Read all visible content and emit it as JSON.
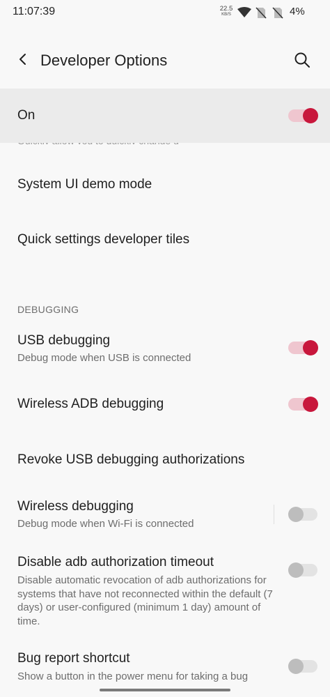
{
  "status_bar": {
    "time": "11:07:39",
    "net_speed_value": "22.5",
    "net_speed_unit": "KB/S",
    "battery": "4%",
    "icons": [
      "wifi-icon",
      "no-sim-icon",
      "no-sim-icon"
    ]
  },
  "app_bar": {
    "title": "Developer Options",
    "back_icon": "back-arrow-icon",
    "search_icon": "search-icon"
  },
  "master_switch": {
    "label": "On",
    "checked": true
  },
  "partially_hidden_summary": "Quickly allow you to quickly change g",
  "items": [
    {
      "title": "System UI demo mode"
    },
    {
      "title": "Quick settings developer tiles"
    }
  ],
  "debugging": {
    "header": "DEBUGGING",
    "items": [
      {
        "title": "USB debugging",
        "summary": "Debug mode when USB is connected",
        "checked": true
      },
      {
        "title": "Wireless ADB debugging",
        "checked": true
      },
      {
        "title": "Revoke USB debugging authorizations"
      },
      {
        "title": "Wireless debugging",
        "summary": "Debug mode when Wi-Fi is connected",
        "checked": false
      },
      {
        "title": "Disable adb authorization timeout",
        "summary": "Disable automatic revocation of adb authorizations for systems that have not reconnected within the default (7 days) or user-configured (minimum 1 day) amount of time.",
        "checked": false
      },
      {
        "title": "Bug report shortcut",
        "summary": "Show a button in the power menu for taking a bug",
        "checked": false
      }
    ]
  },
  "colors": {
    "accent": "#c8173c",
    "accent_track": "#efc6cf",
    "background": "#f8f8f8",
    "highlight_row": "#ebebeb"
  }
}
